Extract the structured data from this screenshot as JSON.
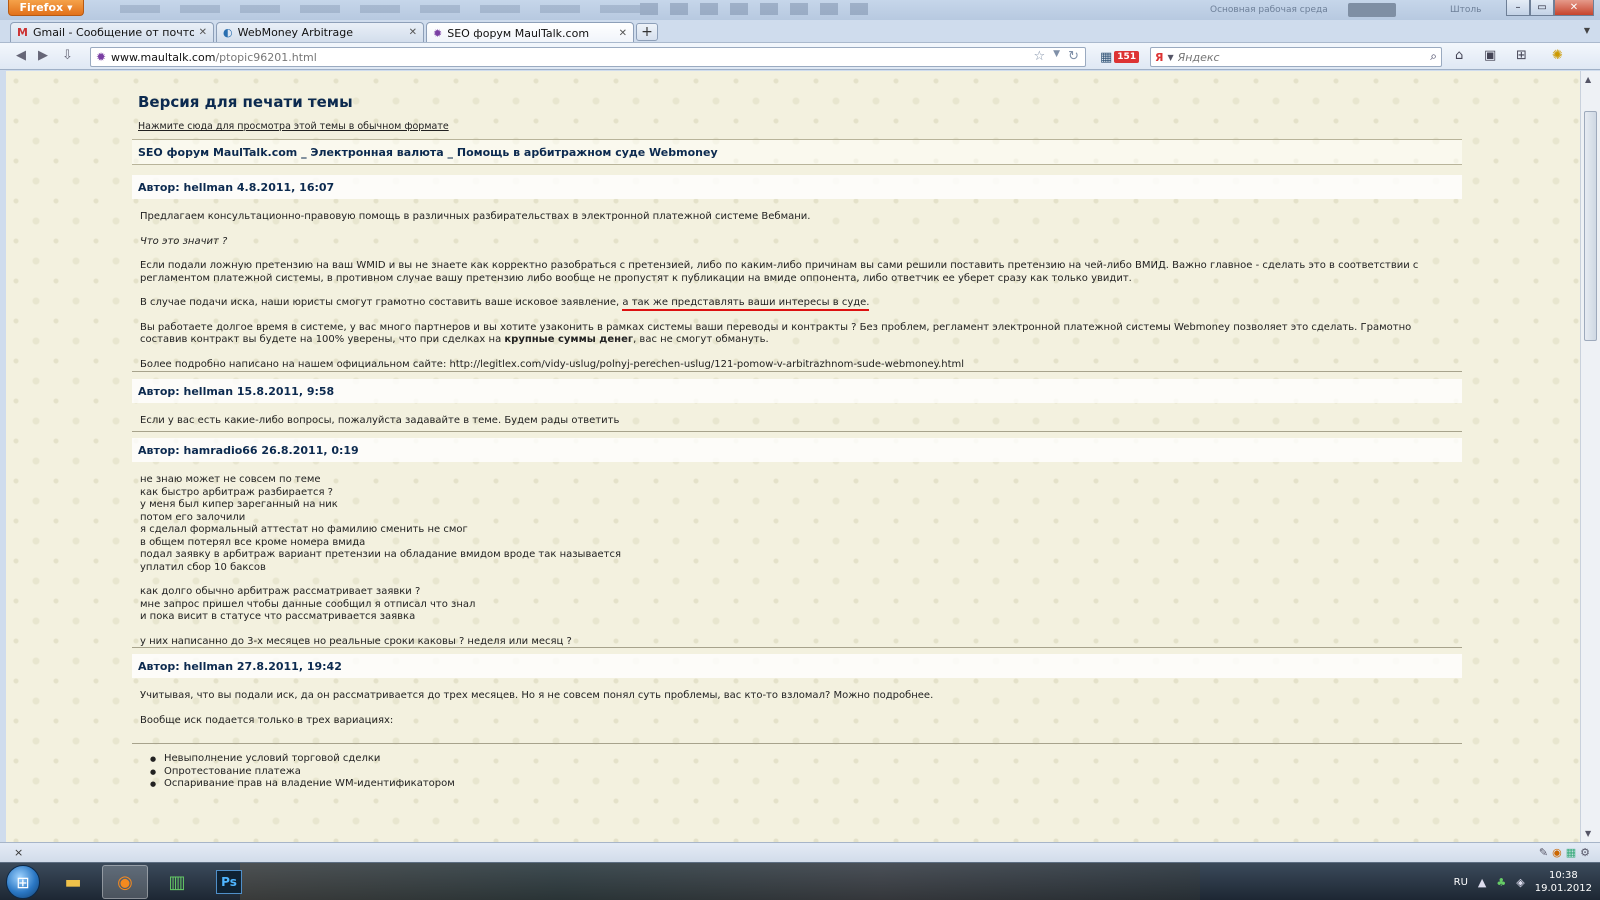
{
  "browser": {
    "app_button": "Firefox",
    "title_right_text": "Основная рабочая среда",
    "title_right_text2": "Штоль",
    "tabs": [
      {
        "title": "Gmail - Сообщение от почтового р...",
        "icon": "gmail-icon",
        "active": false
      },
      {
        "title": "WebMoney Arbitrage",
        "icon": "webmoney-icon",
        "active": false
      },
      {
        "title": "SEO форум MaulTalk.com",
        "icon": "maultalk-icon",
        "active": true
      }
    ],
    "new_tab_label": "+",
    "url_host": "www.maultalk.com",
    "url_path": "/ptopic96201.html",
    "badge_count": "151",
    "search_placeholder": "Яндекс"
  },
  "page": {
    "title": "Версия для печати темы",
    "normal_view_link": "Нажмите сюда для просмотра этой темы в обычном формате",
    "forum_path": "SEO форум MaulTalk.com _ Электронная валюта _ Помощь в арбитражном суде Webmoney"
  },
  "posts": [
    {
      "header": "Автор: hellman 4.8.2011, 16:07",
      "p1": "Предлагаем консультационно-правовую помощь в различных разбирательствах в электронной платежной системе Вебмани.",
      "p2": "Что это значит ?",
      "p3": "Если подали ложную претензию на ваш WMID и вы не знаете как корректно разобраться с претензией, либо по каким-либо причинам вы сами решили поставить претензию на чей-либо ВМИД. Важно главное - сделать это в соответствии с регламентом платежной системы, в противном случае вашу претензию либо вообще не пропустят к публикации на вмиде оппонента, либо ответчик ее уберет сразу как только увидит.",
      "p4_start": "В случае подачи иска, наши юристы смогут грамотно составить ваше исковое заявление,",
      "p4_underlined": "а так же представлять ваши интересы в суде.",
      "p5_start": "Вы работаете долгое время в системе, у вас много партнеров и вы хотите узаконить в рамках системы ваши переводы и контракты ? Без проблем, регламент электронной платежной системы Webmoney позволяет это сделать. Грамотно составив контракт вы будете на 100% уверены, что при сделках на",
      "p5_bold": "крупные суммы денег",
      "p5_end": ", вас не смогут обмануть.",
      "p6": "Более подробно написано на нашем официальном сайте: http://legitlex.com/vidy-uslug/polnyj-perechen-uslug/121-pomow-v-arbitrazhnom-sude-webmoney.html"
    },
    {
      "header": "Автор: hellman 15.8.2011, 9:58",
      "p1": "Если у вас есть какие-либо вопросы, пожалуйста задавайте в теме. Будем рады ответить"
    },
    {
      "header": "Автор: hamradio66 26.8.2011, 0:19",
      "lines_a": [
        "не знаю может не совсем по теме",
        "как быстро арбитраж разбирается ?",
        "у меня был кипер зареганный на ник",
        "потом его залочили",
        "я сделал формальный аттестат но фамилию сменить не смог",
        "в общем потерял все кроме номера вмида",
        "подал заявку в арбитраж вариант претензии на обладание вмидом вроде так называется",
        "уплатил сбор 10 баксов"
      ],
      "lines_b": [
        "как долго обычно арбитраж рассматривает заявки ?",
        "мне запрос пришел чтобы данные сообщил я отписал что знал",
        "и пока висит в статусе что рассматривается заявка"
      ],
      "p_last": "у них написанно до 3-х месяцев но реальные сроки каковы ? неделя или месяц ?"
    },
    {
      "header": "Автор: hellman 27.8.2011, 19:42",
      "p1": "Учитывая, что вы подали иск, да он рассматривается до трех месяцев. Но я не совсем понял суть проблемы, вас кто-то взломал? Можно подробнее.",
      "p2": "Вообще иск подается только в трех вариациях:",
      "bullets": [
        "Невыполнение условий торговой сделки",
        "Опротестование платежа",
        "Оспаривание прав на владение WM-идентификатором"
      ]
    }
  ],
  "statusbar": {
    "close": "×"
  },
  "taskbar": {
    "language": "RU",
    "time": "10:38",
    "date": "19.01.2012",
    "ps_label": "Ps"
  }
}
